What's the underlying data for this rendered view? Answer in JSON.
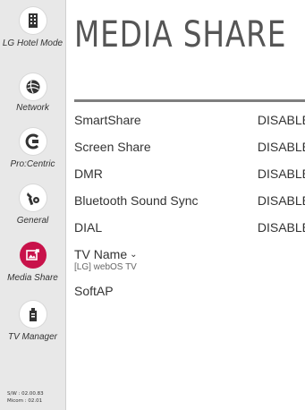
{
  "sidebar": {
    "items": [
      {
        "label": "LG Hotel Mode",
        "icon": "hotel-building-icon",
        "active": false
      },
      {
        "label": "Network",
        "icon": "globe-icon",
        "active": false
      },
      {
        "label": "Pro:Centric",
        "icon": "procentric-icon",
        "active": false
      },
      {
        "label": "General",
        "icon": "tools-gear-icon",
        "active": false
      },
      {
        "label": "Media Share",
        "icon": "media-share-icon",
        "active": true
      },
      {
        "label": "TV Manager",
        "icon": "tv-manager-icon",
        "active": false
      }
    ],
    "footer": {
      "sw": "S/W : 02.00.83",
      "micom": "Micom : 02.01"
    }
  },
  "page": {
    "title": "MEDIA SHARE",
    "settings": [
      {
        "label": "SmartShare",
        "value": "DISABLE"
      },
      {
        "label": "Screen Share",
        "value": "DISABLE"
      },
      {
        "label": "DMR",
        "value": "DISABLE"
      },
      {
        "label": "Bluetooth Sound Sync",
        "value": "DISABLE"
      },
      {
        "label": "DIAL",
        "value": "DISABLE"
      }
    ],
    "tv_name": {
      "label": "TV Name",
      "value": "[LG] webOS TV"
    },
    "softap": {
      "label": "SoftAP"
    }
  },
  "colors": {
    "accent": "#c8124a",
    "sidebar_bg": "#e8e8e8",
    "rule": "#7f7f7f"
  }
}
